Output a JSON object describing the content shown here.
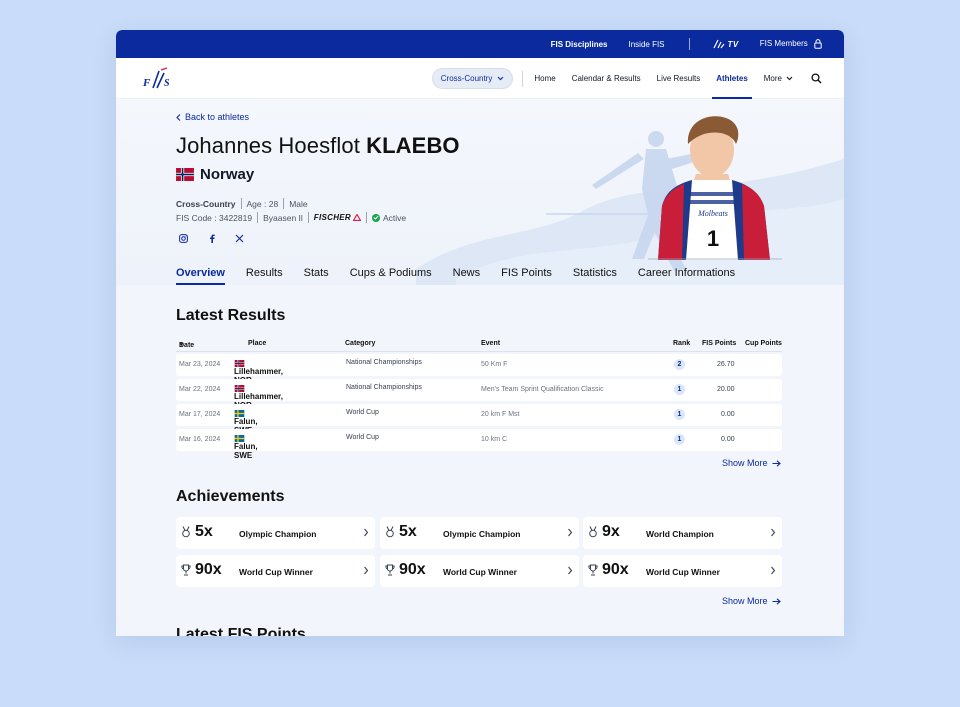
{
  "topbar": {
    "disciplines": "FIS Disciplines",
    "inside": "Inside FIS",
    "tv_label": "TV",
    "members": "FIS Members"
  },
  "nav": {
    "discipline_select": "Cross-Country",
    "links": [
      "Home",
      "Calendar & Results",
      "Live Results",
      "Athletes"
    ],
    "active_link": "Athletes",
    "more": "More"
  },
  "athlete": {
    "back": "Back to athletes",
    "first_name": "Johannes Hoesflot",
    "last_name": "KLAEBO",
    "country": "Norway",
    "discipline": "Cross-Country",
    "age": "Age : 28",
    "gender": "Male",
    "fis_code": "FIS Code : 3422819",
    "club": "Byaasen Il",
    "sponsor": "FISCHER",
    "status": "Active",
    "bib_number": "1",
    "bib_brand": "Molbeats"
  },
  "tabs": [
    "Overview",
    "Results",
    "Stats",
    "Cups & Podiums",
    "News",
    "FIS Points",
    "Statistics",
    "Career Informations"
  ],
  "latest_results": {
    "title": "Latest  Results",
    "columns": {
      "date": "Date",
      "place": "Place",
      "category": "Category",
      "event": "Event",
      "rank": "Rank",
      "fis_points": "FIS Points",
      "cup_points": "Cup Points"
    },
    "rows": [
      {
        "date": "Mar 23, 2024",
        "place": "Lillehammer, NOR",
        "category": "National Championships",
        "event": "50 Km F",
        "rank": "2",
        "fis_points": "26.70",
        "cup_points": "",
        "flag": "norway"
      },
      {
        "date": "Mar 22, 2024",
        "place": "Lillehammer, NOR",
        "category": "National Championships",
        "event": "Men's Team Sprint Qualification Classic",
        "rank": "1",
        "fis_points": "20.00",
        "cup_points": "",
        "flag": "norway"
      },
      {
        "date": "Mar 17, 2024",
        "place": "Falun, SWE",
        "category": "World Cup",
        "event": "20 km F Mst",
        "rank": "1",
        "fis_points": "0.00",
        "cup_points": "",
        "flag": "sweden"
      },
      {
        "date": "Mar 16, 2024",
        "place": "Falun, SWE",
        "category": "World Cup",
        "event": "10 km C",
        "rank": "1",
        "fis_points": "0.00",
        "cup_points": "",
        "flag": "sweden"
      }
    ],
    "show_more": "Show More"
  },
  "achievements": {
    "title": "Achievements",
    "items": [
      {
        "count": "5x",
        "label": "Olympic Champion",
        "icon": "medal-icon"
      },
      {
        "count": "5x",
        "label": "Olympic Champion",
        "icon": "medal-icon"
      },
      {
        "count": "9x",
        "label": "World Champion",
        "icon": "medal-icon"
      },
      {
        "count": "90x",
        "label": "World Cup Winner",
        "icon": "trophy-icon"
      },
      {
        "count": "90x",
        "label": "World Cup Winner",
        "icon": "trophy-icon"
      },
      {
        "count": "90x",
        "label": "World Cup Winner",
        "icon": "trophy-icon"
      }
    ],
    "show_more": "Show More"
  },
  "latest_fis_points": {
    "title": "Latest  FIS Points"
  },
  "colors": {
    "brand": "#0a2a9e",
    "page_bg": "#c9dcf9",
    "active": "#16a34a",
    "rank_bg": "#dbe6f7"
  }
}
